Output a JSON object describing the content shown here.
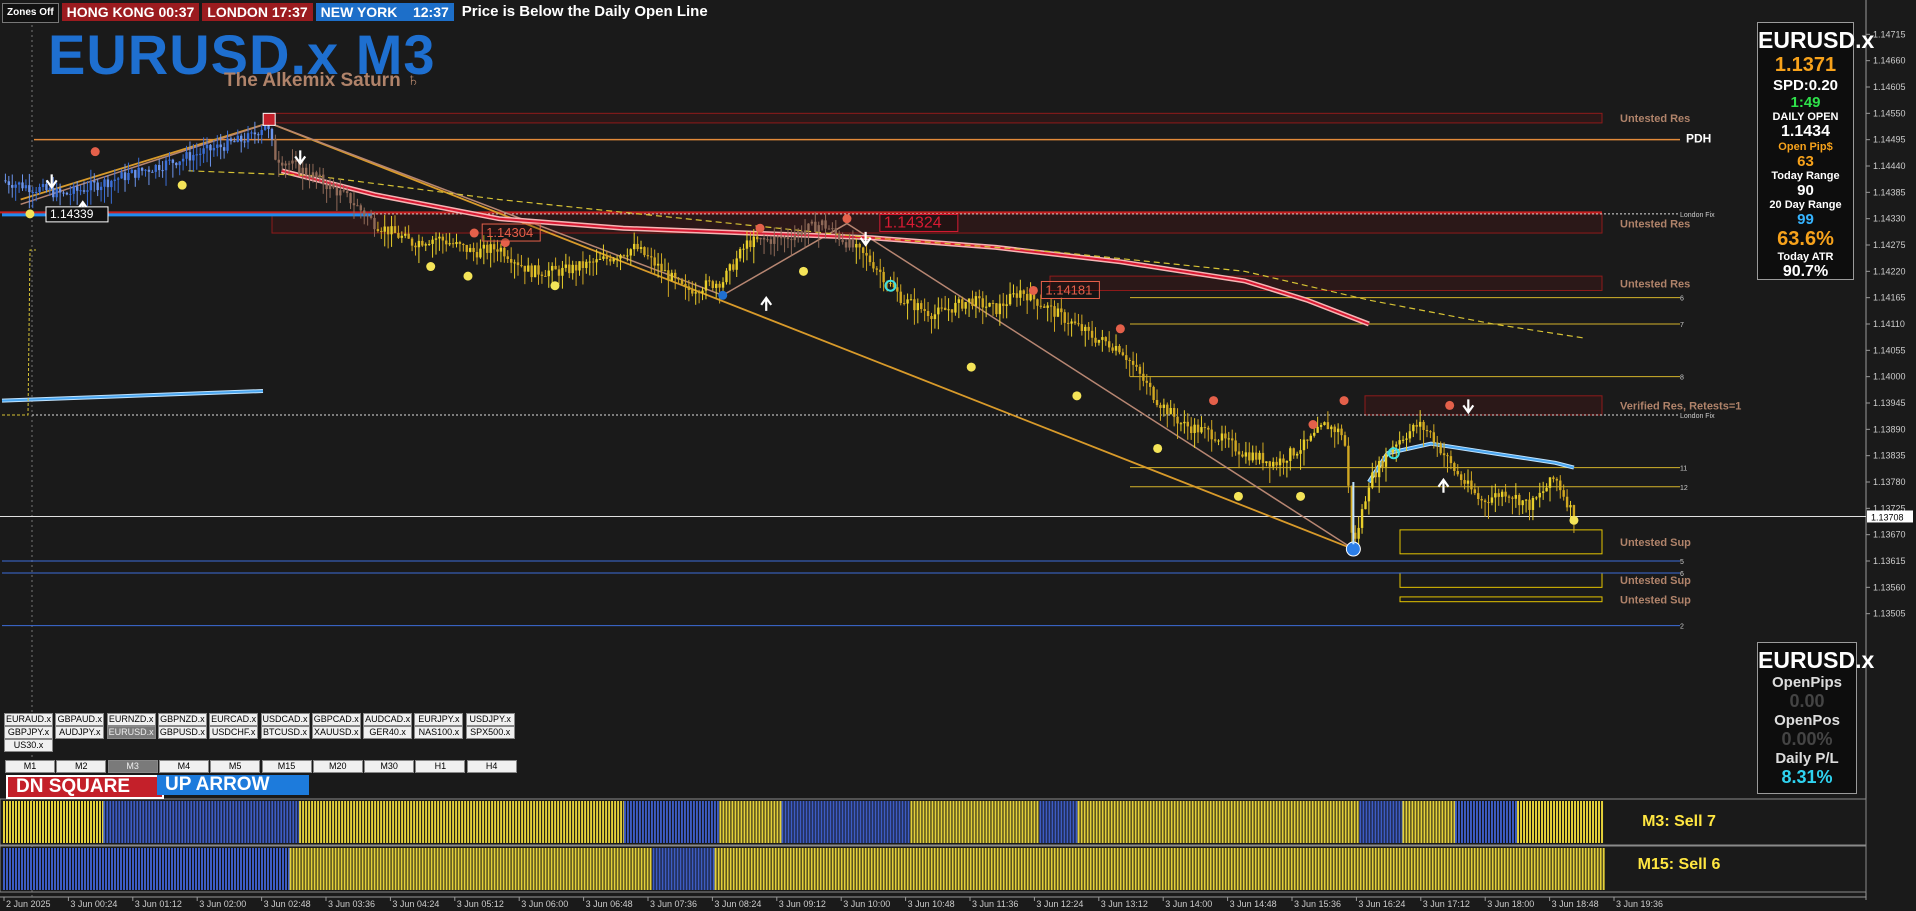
{
  "topbar": {
    "zones": "Zones Off",
    "sessions": [
      {
        "name": "HONG KONG",
        "time": "00:37"
      },
      {
        "name": "LONDON",
        "time": "17:37"
      },
      {
        "name": "NEW YORK",
        "time": "12:37"
      }
    ],
    "message": "Price is Below the Daily Open Line"
  },
  "title": "EURUSD.x M3",
  "subtitle": "The Alkemix Saturn ♄",
  "colors": {
    "bg": "#1a1a1a",
    "bull": "#e9cf2b",
    "bear": "#8f6a58",
    "blue_candle": "#3b6fd8",
    "ma_red": "#d81a33",
    "ma_blue": "#4aa6f0",
    "heat_yellow": "#e4d03a",
    "heat_blue": "#3d5cc4",
    "res_zone": "#8f1a1a"
  },
  "info_panel_top": {
    "symbol": "EURUSD.x",
    "price": "1.1371",
    "spread": "SPD:0.20",
    "timer": "1:49",
    "daily_open_label": "DAILY OPEN",
    "daily_open": "1.1434",
    "open_pips_label": "Open Pip$",
    "open_pips": "63",
    "today_range_label": "Today Range",
    "today_range": "90",
    "range20_label": "20 Day Range",
    "range20": "99",
    "atr_pct": "63.6%",
    "atr_label": "Today ATR",
    "atr2": "90.7%"
  },
  "info_panel_bottom": {
    "symbol": "EURUSD.x",
    "open_pips_label": "OpenPips",
    "open_pips": "0.00",
    "open_pos_label": "OpenPos",
    "open_pos": "0.00%",
    "daily_pl_label": "Daily P/L",
    "daily_pl": "8.31%"
  },
  "pair_buttons": [
    "EURAUD.x",
    "GBPAUD.x",
    "EURNZD.x",
    "GBPNZD.x",
    "EURCAD.x",
    "USDCAD.x",
    "GBPCAD.x",
    "AUDCAD.x",
    "EURJPY.x",
    "USDJPY.x",
    "GBPJPY.x",
    "AUDJPY.x",
    "EURUSD.x",
    "GBPUSD.x",
    "USDCHF.x",
    "BTCUSD.x",
    "XAUUSD.x",
    "GER40.x",
    "NAS100.x",
    "SPX500.x",
    "US30.x"
  ],
  "selected_pair": "EURUSD.x",
  "timeframes": [
    "M1",
    "M2",
    "M3",
    "M4",
    "M5",
    "M15",
    "M20",
    "M30",
    "H1",
    "H4"
  ],
  "selected_timeframe": "M3",
  "signals": {
    "dn": "DN SQUARE",
    "up": "UP ARROW"
  },
  "heatmap_labels": [
    "M3: Sell 7",
    "M15: Sell 6"
  ],
  "chart_data": {
    "type": "candlestick",
    "y_range": [
      1.1345,
      1.1477
    ],
    "y_ticks": [
      "1.14715",
      "1.14660",
      "1.14605",
      "1.14550",
      "1.14495",
      "1.14440",
      "1.14385",
      "1.14330",
      "1.14275",
      "1.14220",
      "1.14165",
      "1.14110",
      "1.14055",
      "1.14000",
      "1.13945",
      "1.13890",
      "1.13835",
      "1.13780",
      "1.13725",
      "1.13670",
      "1.13615",
      "1.13560",
      "1.13505"
    ],
    "current_price": "1.13708",
    "x_ticks": [
      "2 Jun 2025",
      "3 Jun 00:24",
      "3 Jun 01:12",
      "3 Jun 02:00",
      "3 Jun 02:48",
      "3 Jun 03:36",
      "3 Jun 04:24",
      "3 Jun 05:12",
      "3 Jun 06:00",
      "3 Jun 06:48",
      "3 Jun 07:36",
      "3 Jun 08:24",
      "3 Jun 09:12",
      "3 Jun 10:00",
      "3 Jun 10:48",
      "3 Jun 11:36",
      "3 Jun 12:24",
      "3 Jun 13:12",
      "3 Jun 14:00",
      "3 Jun 14:48",
      "3 Jun 15:36",
      "3 Jun 16:24",
      "3 Jun 17:12",
      "3 Jun 18:00",
      "3 Jun 18:48",
      "3 Jun 19:36"
    ],
    "price_path": [
      {
        "t": 0,
        "p": 1.1441
      },
      {
        "t": 1,
        "p": 1.1438
      },
      {
        "t": 2,
        "p": 1.1442
      },
      {
        "t": 3,
        "p": 1.1446
      },
      {
        "t": 4,
        "p": 1.145
      },
      {
        "t": 4.25,
        "p": 1.1453
      },
      {
        "t": 4.4,
        "p": 1.1446
      },
      {
        "t": 5,
        "p": 1.1442
      },
      {
        "t": 5.6,
        "p": 1.1437
      },
      {
        "t": 6,
        "p": 1.1432
      },
      {
        "t": 6.6,
        "p": 1.1428
      },
      {
        "t": 7,
        "p": 1.1429
      },
      {
        "t": 7.6,
        "p": 1.1426
      },
      {
        "t": 8,
        "p": 1.1427
      },
      {
        "t": 8.5,
        "p": 1.1422
      },
      {
        "t": 9,
        "p": 1.1422
      },
      {
        "t": 9.6,
        "p": 1.1424
      },
      {
        "t": 10.2,
        "p": 1.1427
      },
      {
        "t": 11,
        "p": 1.1418
      },
      {
        "t": 11.6,
        "p": 1.142
      },
      {
        "t": 12,
        "p": 1.1428
      },
      {
        "t": 12.6,
        "p": 1.1429
      },
      {
        "t": 13.2,
        "p": 1.1432
      },
      {
        "t": 13.6,
        "p": 1.1428
      },
      {
        "t": 14,
        "p": 1.1424
      },
      {
        "t": 14.5,
        "p": 1.1416
      },
      {
        "t": 15,
        "p": 1.1413
      },
      {
        "t": 15.6,
        "p": 1.1416
      },
      {
        "t": 16,
        "p": 1.1414
      },
      {
        "t": 16.4,
        "p": 1.1418
      },
      {
        "t": 17,
        "p": 1.1413
      },
      {
        "t": 17.6,
        "p": 1.1408
      },
      {
        "t": 18,
        "p": 1.1406
      },
      {
        "t": 18.6,
        "p": 1.1395
      },
      {
        "t": 19,
        "p": 1.139
      },
      {
        "t": 19.5,
        "p": 1.1388
      },
      {
        "t": 20,
        "p": 1.1384
      },
      {
        "t": 20.5,
        "p": 1.1382
      },
      {
        "t": 21,
        "p": 1.1386
      },
      {
        "t": 21.3,
        "p": 1.139
      },
      {
        "t": 21.6,
        "p": 1.1388
      },
      {
        "t": 21.75,
        "p": 1.1364
      },
      {
        "t": 22,
        "p": 1.1378
      },
      {
        "t": 22.4,
        "p": 1.1386
      },
      {
        "t": 22.8,
        "p": 1.139
      },
      {
        "t": 23,
        "p": 1.1388
      },
      {
        "t": 23.4,
        "p": 1.138
      },
      {
        "t": 23.8,
        "p": 1.1374
      },
      {
        "t": 24.2,
        "p": 1.1376
      },
      {
        "t": 24.6,
        "p": 1.1373
      },
      {
        "t": 25,
        "p": 1.1379
      },
      {
        "t": 25.3,
        "p": 1.1371
      }
    ],
    "ma_red": [
      [
        4.5,
        1.1443
      ],
      [
        6,
        1.1438
      ],
      [
        8,
        1.1433
      ],
      [
        10,
        1.1431
      ],
      [
        12,
        1.143
      ],
      [
        14,
        1.1429
      ],
      [
        16,
        1.1427
      ],
      [
        18,
        1.1424
      ],
      [
        20,
        1.142
      ],
      [
        21,
        1.1416
      ],
      [
        22,
        1.1411
      ]
    ],
    "ma_blue": [
      [
        22,
        1.1378
      ],
      [
        22.3,
        1.1384
      ],
      [
        23,
        1.1386
      ],
      [
        24,
        1.1384
      ],
      [
        25,
        1.1382
      ],
      [
        25.3,
        1.1381
      ]
    ],
    "ma_blue_left": [
      [
        0,
        1.1395
      ],
      [
        4.2,
        1.1397
      ]
    ],
    "price_labels": [
      {
        "t": 7.6,
        "p": 1.143,
        "text": "1.14304"
      },
      {
        "t": 14.0,
        "p": 1.1432,
        "text": "1.14324"
      },
      {
        "t": 16.6,
        "p": 1.1418,
        "text": "1.14181"
      },
      {
        "t": 1.0,
        "p": 1.1434,
        "text": "1.14339"
      }
    ],
    "zones": [
      {
        "label": "Untested Res",
        "p_top": 1.1455,
        "p_bot": 1.1453
      },
      {
        "label": "Untested Res",
        "p_top": 1.1434,
        "p_bot": 1.143
      },
      {
        "label": "Untested Res",
        "p_top": 1.1421,
        "p_bot": 1.1418
      },
      {
        "label": "Verified Res, Retests=1",
        "p_top": 1.1396,
        "p_bot": 1.1392
      },
      {
        "label": "Untested Sup",
        "p_top": 1.1368,
        "p_bot": 1.1363
      },
      {
        "label": "Untested Sup",
        "p_top": 1.1359,
        "p_bot": 1.1356
      },
      {
        "label": "Untested Sup",
        "p_top": 1.1354,
        "p_bot": 1.1353
      }
    ],
    "level_lines": [
      {
        "label": "PDH",
        "p": 1.14495
      },
      {
        "label": "London Fix",
        "p": 1.1434
      },
      {
        "label": "6",
        "p": 1.14165
      },
      {
        "label": "7",
        "p": 1.1411
      },
      {
        "label": "8",
        "p": 1.14
      },
      {
        "label": "London Fix",
        "p": 1.1392
      },
      {
        "label": "11",
        "p": 1.1381
      },
      {
        "label": "12",
        "p": 1.1377
      },
      {
        "label": "5",
        "p": 1.13615
      },
      {
        "label": "6",
        "p": 1.1359
      },
      {
        "label": "2",
        "p": 1.1348
      }
    ],
    "heatmap_rows": [
      {
        "label": "M3: Sell 7",
        "segments": [
          [
            "Y",
            0,
            2.1
          ],
          [
            "B",
            2.1,
            6.2
          ],
          [
            "Y",
            6.2,
            13
          ],
          [
            "B",
            13,
            15
          ],
          [
            "Y",
            15,
            16.3
          ],
          [
            "B",
            16.3,
            19
          ],
          [
            "Y",
            19,
            21.7
          ],
          [
            "B",
            21.7,
            22.5
          ],
          [
            "Y",
            22.5,
            28.4
          ],
          [
            "B",
            28.4,
            29.3
          ],
          [
            "Y",
            29.3,
            30.4
          ],
          [
            "B",
            30.4,
            31.7
          ],
          [
            "Y",
            31.7,
            33.5
          ]
        ]
      },
      {
        "label": "M15: Sell 6",
        "segments": [
          [
            "B",
            0,
            6
          ],
          [
            "Y",
            6,
            13.6
          ],
          [
            "B",
            13.6,
            14.9
          ],
          [
            "Y",
            14.9,
            33.5
          ]
        ]
      }
    ]
  }
}
